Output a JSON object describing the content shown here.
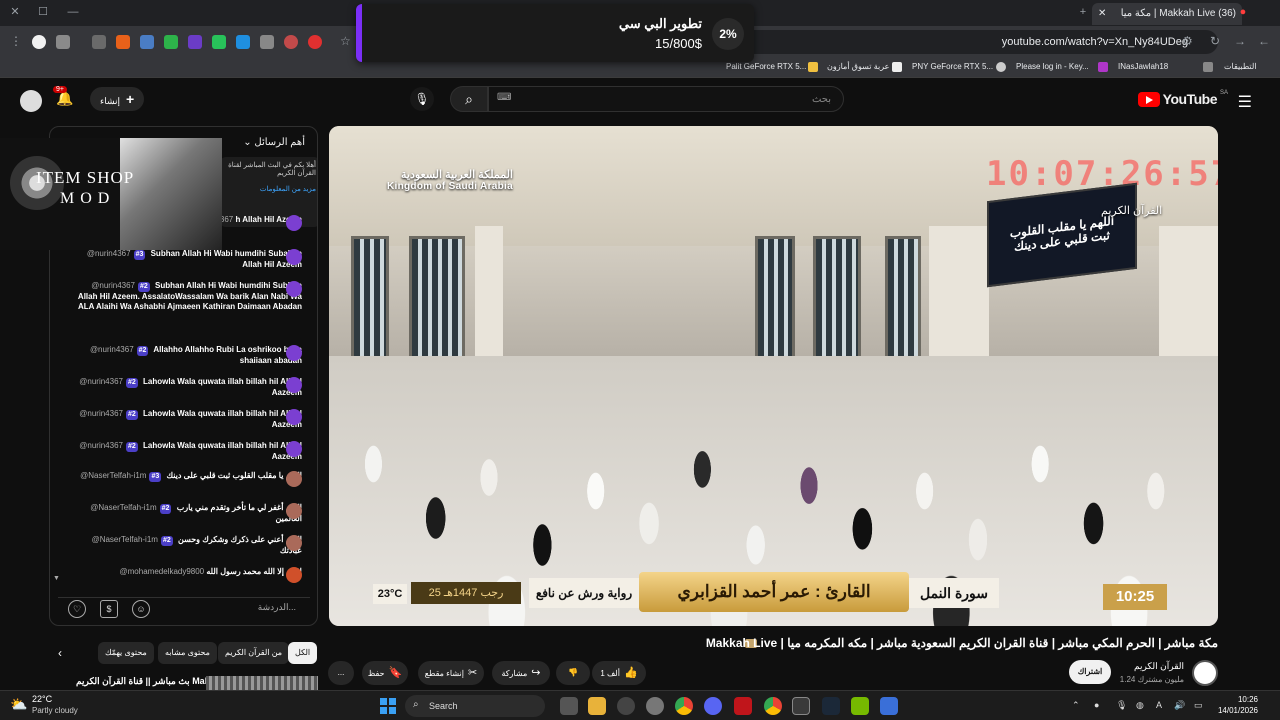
{
  "browser": {
    "tab_title": "(36) Makkah Live | مكة ميا",
    "tab_counter": "(36)",
    "url": "youtube.com/watch?v=Xn_Ny84UDeg",
    "bookmarks": [
      "التطبيقات",
      "INasJawlah18",
      "Please log in - Key...",
      "PNY GeForce RTX 5...",
      "عربة تسوق أمازون",
      "Palit GeForce RTX 5..."
    ]
  },
  "notification": {
    "percent": "2%",
    "title": "تطوير البي سي",
    "amount": "15/800$"
  },
  "yt_header": {
    "logo": "YouTube",
    "region": "SA",
    "search_placeholder": "بحث",
    "create_label": "إنشاء",
    "notif_count": "9+"
  },
  "video": {
    "ksa_ar": "المملكة العربية السعودية",
    "ksa_en": "Kingdom of Saudi Arabia",
    "led_line1": "اللهم يا مقلب القلوب",
    "led_line2": "ثبت قلبي على دينك",
    "clock_ghost": "10:07:26:57",
    "channel_tag": "القرآن الكريم",
    "reciter": "القارئ : عمر أحمد القزابري",
    "surah": "سورة النمل",
    "riwaya": "رواية ورش عن نافع",
    "date": "25 رجب 1447هـ",
    "temp": "23°C",
    "time": "10:25"
  },
  "chat": {
    "header": "أهم الرسائل",
    "pinned_text": "أهلا بكم في البث المباشر لقناة القرآن الكريم",
    "pinned_more": "مزيد من المعلومات",
    "input_placeholder": "الدردشة...",
    "messages": [
      {
        "user": "@nurin4367",
        "rank": "",
        "text": "h Allah Hil Azeem"
      },
      {
        "user": "@nurin4367",
        "rank": "#3",
        "text": "Subhan Allah Hi Wabi humdihi Subahan Allah Hil Azeem"
      },
      {
        "user": "@nurin4367",
        "rank": "#2",
        "text": "Subhan Allah Hi Wabi humdihi Subhan Allah Hil Azeem. AssalatoWassalam Wa barik Alan Nabi Wa ALA Alaihi Wa Ashabhi Ajmaeen Kathiran Daimaan Abadan"
      },
      {
        "user": "@nurin4367",
        "rank": "#2",
        "text": "Allahho Allahho Rubi La oshrikoo beka shaiiaan abadan"
      },
      {
        "user": "@nurin4367",
        "rank": "#2",
        "text": "Lahowla Wala quwata illah billah hil Aliyol Aazeem"
      },
      {
        "user": "@nurin4367",
        "rank": "#2",
        "text": "Lahowla Wala quwata illah billah hil Aliyol Aazeem"
      },
      {
        "user": "@nurin4367",
        "rank": "#2",
        "text": "Lahowla Wala quwata illah billah hil Aliyol Aazeem"
      },
      {
        "user": "@NaserTelfah-i1m",
        "rank": "#3",
        "text": "اللهم يا مقلب القلوب ثبت قلبي على دينك"
      },
      {
        "user": "@NaserTelfah-i1m",
        "rank": "#2",
        "text": "اللهم أغفر لي ما تأخر وتقدم مني يارب العالمين"
      },
      {
        "user": "@NaserTelfah-i1m",
        "rank": "#2",
        "text": "اللهم أعني على ذكرك وشكرك وحسن عبادتك"
      },
      {
        "user": "@mohamedelkady9800",
        "rank": "",
        "text": "لا إله إلا الله محمد رسول الله"
      }
    ]
  },
  "overlay": {
    "line1": "ITEM SHOP",
    "line2": "MOD"
  },
  "below": {
    "title": "Makkah Live | مكة مباشر | الحرم المكي مباشر | قناة القران الكريم السعودية مباشر | مكه المكرمه ميا",
    "channel": "القرآن الكريم",
    "subs": "1.24 مليون مشترك",
    "subscribe": "اشتراك",
    "likes": "1 ألف",
    "share": "مشاركة",
    "clip": "إنشاء مقطع",
    "save": "حفظ",
    "more": "..."
  },
  "chips": [
    "الكل",
    "من القرآن الكريم",
    "محتوى مشابه",
    "محتوى يهمّك"
  ],
  "next_video": "بث مباشر || قناة القرآن الكريم Makkah",
  "taskbar": {
    "temp": "22°C",
    "weather": "Partly cloudy",
    "search": "Search",
    "time": "10:26",
    "date": "14/01/2026"
  },
  "colors": {
    "accent_red": "#ff0000",
    "notif_purple": "#7b2ff7",
    "rank_badge": "#4b3fc7",
    "gold": "#c89b3b"
  }
}
